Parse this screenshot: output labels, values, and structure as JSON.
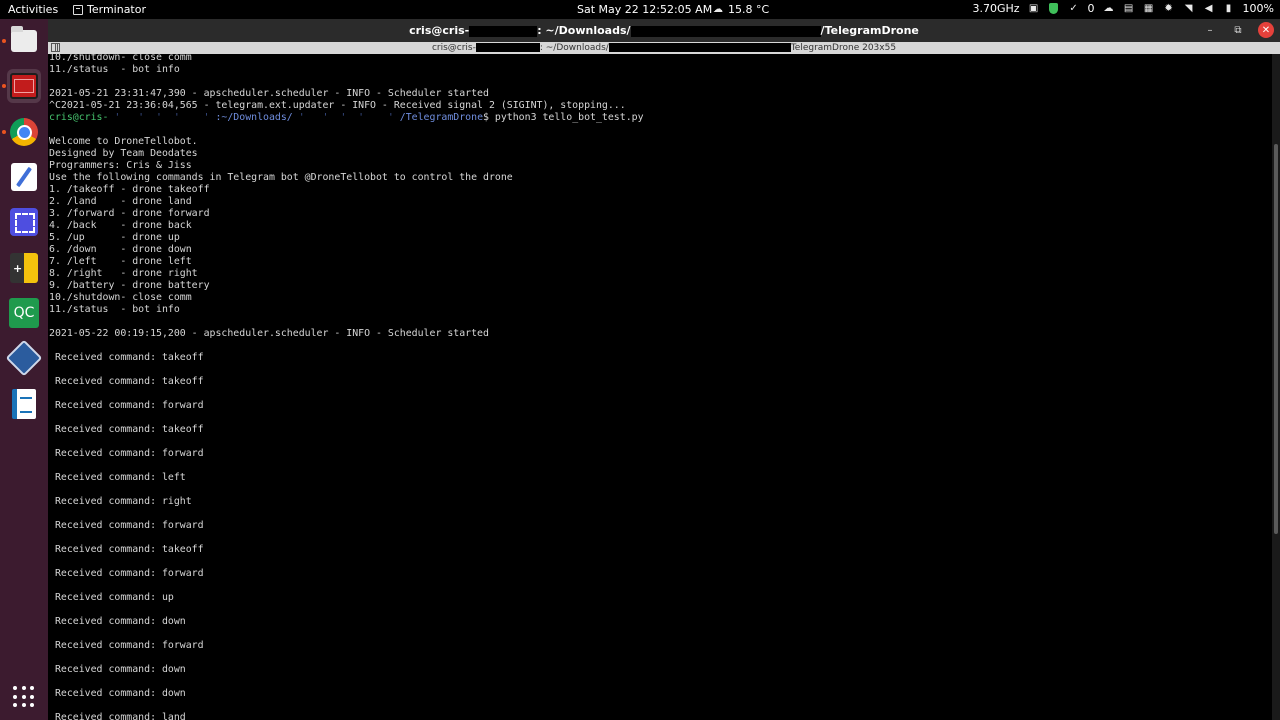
{
  "topbar": {
    "activities": "Activities",
    "app_name": "Terminator",
    "clock": "Sat May 22  12:52:05 AM",
    "weather": "15.8 °C",
    "cpu_freq": "3.70GHz",
    "check_count": "0",
    "battery": "100%",
    "icons": [
      "weather-icon",
      "cpu-icon",
      "shield-icon",
      "check-icon",
      "cloud-icon",
      "clipboard-icon",
      "grid-icon",
      "brightness-icon",
      "wifi-icon",
      "volume-icon",
      "battery-icon"
    ]
  },
  "dock": {
    "items": [
      "files",
      "terminator",
      "chrome",
      "text-editor",
      "screenshot",
      "calculator",
      "qcad",
      "virtualbox",
      "writer",
      "show-apps"
    ],
    "accent": "#e95420",
    "background": "#3c1b2f"
  },
  "window": {
    "title_prefix": "cris@cris-",
    "title_mid": ": ~/Downloads/",
    "title_suffix": "/TelegramDrone",
    "tab_prefix": "cris@cris-",
    "tab_mid": ": ~/Downloads/",
    "tab_suffix": "TelegramDrone 203x55"
  },
  "terminal": {
    "prompt": {
      "user": "cris@cris-",
      "path_start": ":~/Downloads/",
      "path_hidden": " '   '  '  '    ' ",
      "path_end": "/TelegramDrone",
      "symbol": "$ ",
      "command": "python3 tello_bot_test.py"
    },
    "lines": [
      "10./shutdown- close comm",
      "11./status  - bot info",
      "",
      "2021-05-21 23:31:47,390 - apscheduler.scheduler - INFO - Scheduler started",
      "^C2021-05-21 23:36:04,565 - telegram.ext.updater - INFO - Received signal 2 (SIGINT), stopping...",
      "__PROMPT__",
      "",
      "Welcome to DroneTellobot.",
      "Designed by Team Deodates",
      "Programmers: Cris & Jiss",
      "Use the following commands in Telegram bot @DroneTellobot to control the drone",
      "1. /takeoff - drone takeoff",
      "2. /land    - drone land",
      "3. /forward - drone forward",
      "4. /back    - drone back",
      "5. /up      - drone up",
      "6. /down    - drone down",
      "7. /left    - drone left",
      "8. /right   - drone right",
      "9. /battery - drone battery",
      "10./shutdown- close comm",
      "11./status  - bot info",
      "",
      "2021-05-22 00:19:15,200 - apscheduler.scheduler - INFO - Scheduler started",
      "",
      " Received command: takeoff",
      "",
      " Received command: takeoff",
      "",
      " Received command: forward",
      "",
      " Received command: takeoff",
      "",
      " Received command: forward",
      "",
      " Received command: left",
      "",
      " Received command: right",
      "",
      " Received command: forward",
      "",
      " Received command: takeoff",
      "",
      " Received command: forward",
      "",
      " Received command: up",
      "",
      " Received command: down",
      "",
      " Received command: forward",
      "",
      " Received command: down",
      "",
      " Received command: down",
      "",
      " Received command: land"
    ]
  }
}
